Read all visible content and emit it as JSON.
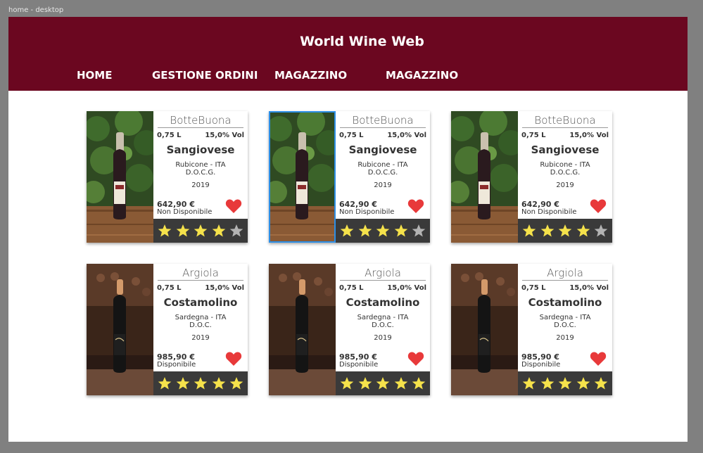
{
  "frame_label": "home - desktop",
  "header": {
    "title": "World Wine Web",
    "nav": [
      "HOME",
      "GESTIONE ORDINI",
      "MAGAZZINO",
      "MAGAZZINO"
    ]
  },
  "colors": {
    "header_bg": "#6b0720",
    "star_filled": "#f5e24b",
    "star_empty": "#b3b3b3",
    "heart": "#e8393a",
    "rating_bar": "#3a3a3a",
    "selection": "#2d8fe6"
  },
  "products": [
    {
      "brand": "BotteBuona",
      "volume": "0,75 L",
      "alcohol": "15,0% Vol",
      "name": "Sangiovese",
      "origin": "Rubicone - ITA",
      "denomination": "D.O.C.G.",
      "vintage": "2019",
      "price": "642,90 €",
      "availability": "Non Disponibile",
      "rating": 4,
      "photo": "outdoor",
      "selected": false
    },
    {
      "brand": "BotteBuona",
      "volume": "0,75 L",
      "alcohol": "15,0% Vol",
      "name": "Sangiovese",
      "origin": "Rubicone - ITA",
      "denomination": "D.O.C.G.",
      "vintage": "2019",
      "price": "642,90 €",
      "availability": "Non Disponibile",
      "rating": 4,
      "photo": "outdoor",
      "selected": true
    },
    {
      "brand": "BotteBuona",
      "volume": "0,75 L",
      "alcohol": "15,0% Vol",
      "name": "Sangiovese",
      "origin": "Rubicone - ITA",
      "denomination": "D.O.C.G.",
      "vintage": "2019",
      "price": "642,90 €",
      "availability": "Non Disponibile",
      "rating": 4,
      "photo": "outdoor",
      "selected": false
    },
    {
      "brand": "Argiola",
      "volume": "0,75 L",
      "alcohol": "15,0% Vol",
      "name": "Costamolino",
      "origin": "Sardegna - ITA",
      "denomination": "D.O.C.",
      "vintage": "2019",
      "price": "985,90 €",
      "availability": "Disponibile",
      "rating": 5,
      "photo": "cellar",
      "selected": false
    },
    {
      "brand": "Argiola",
      "volume": "0,75 L",
      "alcohol": "15,0% Vol",
      "name": "Costamolino",
      "origin": "Sardegna - ITA",
      "denomination": "D.O.C.",
      "vintage": "2019",
      "price": "985,90 €",
      "availability": "Disponibile",
      "rating": 5,
      "photo": "cellar",
      "selected": false
    },
    {
      "brand": "Argiola",
      "volume": "0,75 L",
      "alcohol": "15,0% Vol",
      "name": "Costamolino",
      "origin": "Sardegna - ITA",
      "denomination": "D.O.C.",
      "vintage": "2019",
      "price": "985,90 €",
      "availability": "Disponibile",
      "rating": 5,
      "photo": "cellar",
      "selected": false
    }
  ]
}
